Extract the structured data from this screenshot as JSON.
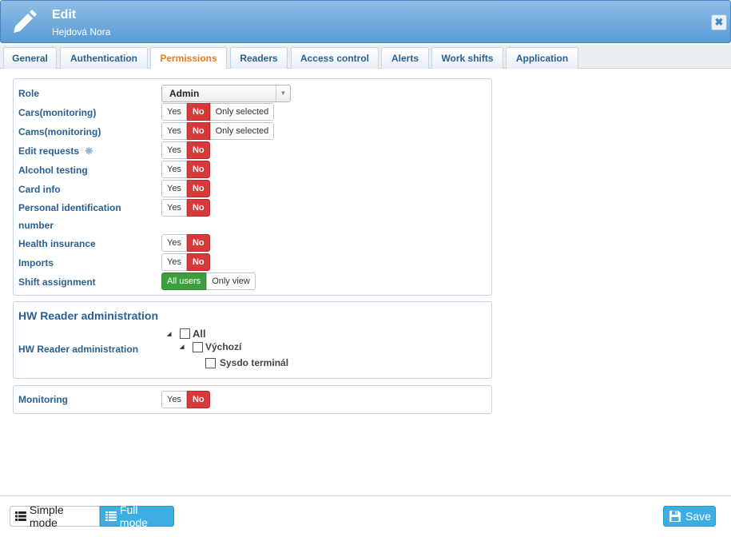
{
  "header": {
    "title": "Edit",
    "subtitle": "Hejdová Nora",
    "icon": "pencil-icon",
    "close_icon": "close-icon",
    "close_glyph": "✖"
  },
  "tabs": [
    {
      "label": "General"
    },
    {
      "label": "Authentication"
    },
    {
      "label": "Permissions",
      "active": true
    },
    {
      "label": "Readers"
    },
    {
      "label": "Access control"
    },
    {
      "label": "Alerts"
    },
    {
      "label": "Work shifts"
    },
    {
      "label": "Application"
    }
  ],
  "permissions": {
    "role_label": "Role",
    "role_value": "Admin",
    "rows": [
      {
        "label": "Cars(monitoring)",
        "options": [
          "Yes",
          "No",
          "Only selected"
        ],
        "selected": "No"
      },
      {
        "label": "Cams(monitoring)",
        "options": [
          "Yes",
          "No",
          "Only selected"
        ],
        "selected": "No"
      },
      {
        "label": "Edit requests",
        "options": [
          "Yes",
          "No"
        ],
        "selected": "No"
      },
      {
        "label": "Alcohol testing",
        "options": [
          "Yes",
          "No"
        ],
        "selected": "No"
      },
      {
        "label": "Card info",
        "options": [
          "Yes",
          "No"
        ],
        "selected": "No"
      },
      {
        "label": "Personal identification number",
        "options": [
          "Yes",
          "No"
        ],
        "selected": "No"
      },
      {
        "label": "Health insurance",
        "options": [
          "Yes",
          "No"
        ],
        "selected": "No"
      },
      {
        "label": "Imports",
        "options": [
          "Yes",
          "No"
        ],
        "selected": "No"
      },
      {
        "label": "Shift assignment",
        "options": [
          "All users",
          "Only view"
        ],
        "selected": "All users"
      }
    ]
  },
  "hw_reader": {
    "title": "HW Reader administration",
    "label": "HW Reader administration",
    "tree": [
      {
        "label": "All",
        "level": 0,
        "checked": false
      },
      {
        "label": "Výchozí",
        "level": 1,
        "checked": false
      },
      {
        "label": "Sysdo terminál",
        "level": 2,
        "checked": false
      }
    ]
  },
  "monitoring": {
    "label": "Monitoring",
    "options": [
      "Yes",
      "No"
    ],
    "selected": "No"
  },
  "footer": {
    "simple_mode": "Simple mode",
    "full_mode": "Full mode",
    "save": "Save"
  },
  "colors": {
    "accent": "#3eaee2",
    "active_tab": "#e87a1c",
    "no_red": "#d9383a",
    "yes_green": "#3e9e3e"
  }
}
